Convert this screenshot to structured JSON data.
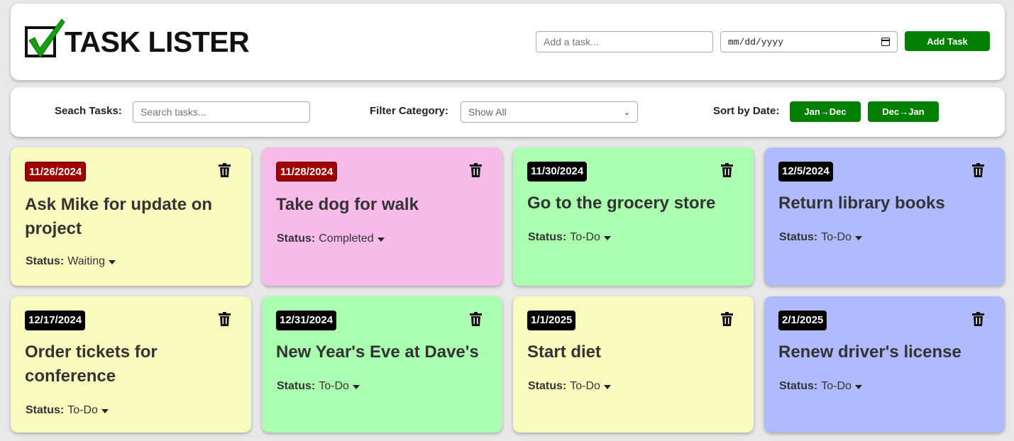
{
  "app": {
    "title": "TASK LISTER"
  },
  "add_form": {
    "task_placeholder": "Add a task...",
    "date_placeholder": "mm/dd/yyyy",
    "add_button": "Add Task"
  },
  "toolbar": {
    "search_label": "Seach Tasks:",
    "search_placeholder": "Search tasks...",
    "filter_label": "Filter Category:",
    "filter_value": "Show All",
    "sort_label": "Sort by Date:",
    "sort_asc": "Jan→Dec",
    "sort_desc": "Dec→Jan"
  },
  "colors": {
    "yellow": "#f8fbbe",
    "pink": "#f9bcea",
    "green": "#abfdaf",
    "blue": "#b0bbfd",
    "overdue_badge": "#a00000",
    "badge": "#000000",
    "button_green": "#008000"
  },
  "tasks": [
    {
      "date": "11/26/2024",
      "title": "Ask Mike for update on project",
      "status_label": "Status:",
      "status": "Waiting",
      "color": "yellow",
      "overdue": true
    },
    {
      "date": "11/28/2024",
      "title": "Take dog for walk",
      "status_label": "Status:",
      "status": "Completed",
      "color": "pink",
      "overdue": true
    },
    {
      "date": "11/30/2024",
      "title": "Go to the grocery store",
      "status_label": "Status:",
      "status": "To-Do",
      "color": "green",
      "overdue": false
    },
    {
      "date": "12/5/2024",
      "title": "Return library books",
      "status_label": "Status:",
      "status": "To-Do",
      "color": "blue",
      "overdue": false
    },
    {
      "date": "12/17/2024",
      "title": "Order tickets for conference",
      "status_label": "Status:",
      "status": "To-Do",
      "color": "yellow",
      "overdue": false
    },
    {
      "date": "12/31/2024",
      "title": "New Year's Eve at Dave's",
      "status_label": "Status:",
      "status": "To-Do",
      "color": "green",
      "overdue": false
    },
    {
      "date": "1/1/2025",
      "title": "Start diet",
      "status_label": "Status:",
      "status": "To-Do",
      "color": "yellow",
      "overdue": false
    },
    {
      "date": "2/1/2025",
      "title": "Renew driver's license",
      "status_label": "Status:",
      "status": "To-Do",
      "color": "blue",
      "overdue": false
    }
  ]
}
